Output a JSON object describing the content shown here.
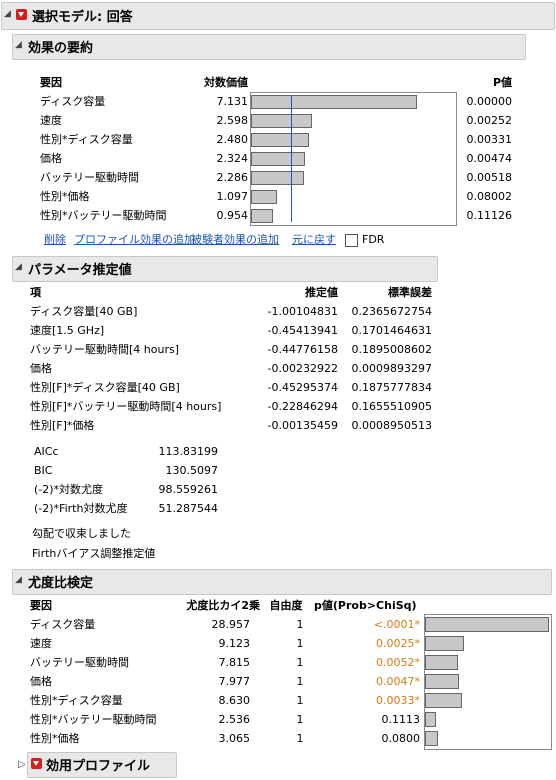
{
  "header": {
    "title": "選択モデル: 回答"
  },
  "effects": {
    "title": "効果の要約",
    "col_factor": "要因",
    "col_logworth": "対数価値",
    "col_pvalue": "P値",
    "rows": [
      {
        "name": "ディスク容量",
        "logworth": "7.131",
        "pvalue": "0.00000",
        "lw": 7.131
      },
      {
        "name": "速度",
        "logworth": "2.598",
        "pvalue": "0.00252",
        "lw": 2.598
      },
      {
        "name": "性別*ディスク容量",
        "logworth": "2.480",
        "pvalue": "0.00331",
        "lw": 2.48
      },
      {
        "name": "価格",
        "logworth": "2.324",
        "pvalue": "0.00474",
        "lw": 2.324
      },
      {
        "name": "バッテリー駆動時間",
        "logworth": "2.286",
        "pvalue": "0.00518",
        "lw": 2.286
      },
      {
        "name": "性別*価格",
        "logworth": "1.097",
        "pvalue": "0.08002",
        "lw": 1.097
      },
      {
        "name": "性別*バッテリー駆動時間",
        "logworth": "0.954",
        "pvalue": "0.11126",
        "lw": 0.954
      }
    ],
    "actions": {
      "remove": "削除",
      "add_profile": "プロファイル効果の追加",
      "add_subject": "被験者効果の追加",
      "undo": "元に戻す",
      "fdr": "FDR"
    }
  },
  "params": {
    "title": "パラメータ推定値",
    "col_term": "項",
    "col_estimate": "推定値",
    "col_se": "標準誤差",
    "rows": [
      {
        "term": "ディスク容量[40 GB]",
        "estimate": "-1.00104831",
        "se": "0.2365672754"
      },
      {
        "term": "速度[1.5 GHz]",
        "estimate": "-0.45413941",
        "se": "0.1701464631"
      },
      {
        "term": "バッテリー駆動時間[4 hours]",
        "estimate": "-0.44776158",
        "se": "0.1895008602"
      },
      {
        "term": "価格",
        "estimate": "-0.00232922",
        "se": "0.0009893297"
      },
      {
        "term": "性別[F]*ディスク容量[40 GB]",
        "estimate": "-0.45295374",
        "se": "0.1875777834"
      },
      {
        "term": "性別[F]*バッテリー駆動時間[4 hours]",
        "estimate": "-0.22846294",
        "se": "0.1655510905"
      },
      {
        "term": "性別[F]*価格",
        "estimate": "-0.00135459",
        "se": "0.0008950513"
      }
    ],
    "stats": [
      {
        "label": "AICc",
        "value": "113.83199"
      },
      {
        "label": "BIC",
        "value": "130.5097"
      },
      {
        "label": "(-2)*対数尤度",
        "value": "98.559261"
      },
      {
        "label": "(-2)*Firth対数尤度",
        "value": "51.287544"
      }
    ],
    "note1": "勾配で収束しました",
    "note2": "Firthバイアス調整推定値"
  },
  "lr": {
    "title": "尤度比検定",
    "col_factor": "要因",
    "col_chisq": "尤度比カイ2乗",
    "col_df": "自由度",
    "col_p": "p値(Prob>ChiSq)",
    "rows": [
      {
        "name": "ディスク容量",
        "chisq": "28.957",
        "df": "1",
        "p": "<.0001*",
        "sig": true,
        "x": 28.957
      },
      {
        "name": "速度",
        "chisq": "9.123",
        "df": "1",
        "p": "0.0025*",
        "sig": true,
        "x": 9.123
      },
      {
        "name": "バッテリー駆動時間",
        "chisq": "7.815",
        "df": "1",
        "p": "0.0052*",
        "sig": true,
        "x": 7.815
      },
      {
        "name": "価格",
        "chisq": "7.977",
        "df": "1",
        "p": "0.0047*",
        "sig": true,
        "x": 7.977
      },
      {
        "name": "性別*ディスク容量",
        "chisq": "8.630",
        "df": "1",
        "p": "0.0033*",
        "sig": true,
        "x": 8.63
      },
      {
        "name": "性別*バッテリー駆動時間",
        "chisq": "2.536",
        "df": "1",
        "p": "0.1113",
        "sig": false,
        "x": 2.536
      },
      {
        "name": "性別*価格",
        "chisq": "3.065",
        "df": "1",
        "p": "0.0800",
        "sig": false,
        "x": 3.065
      }
    ]
  },
  "utility": {
    "title": "効用プロファイル"
  },
  "colors": {
    "bar_fill": "#c8c8c8",
    "ref_line": "#2a4fc0",
    "link": "#1a56b0",
    "sig": "#d97a14"
  }
}
